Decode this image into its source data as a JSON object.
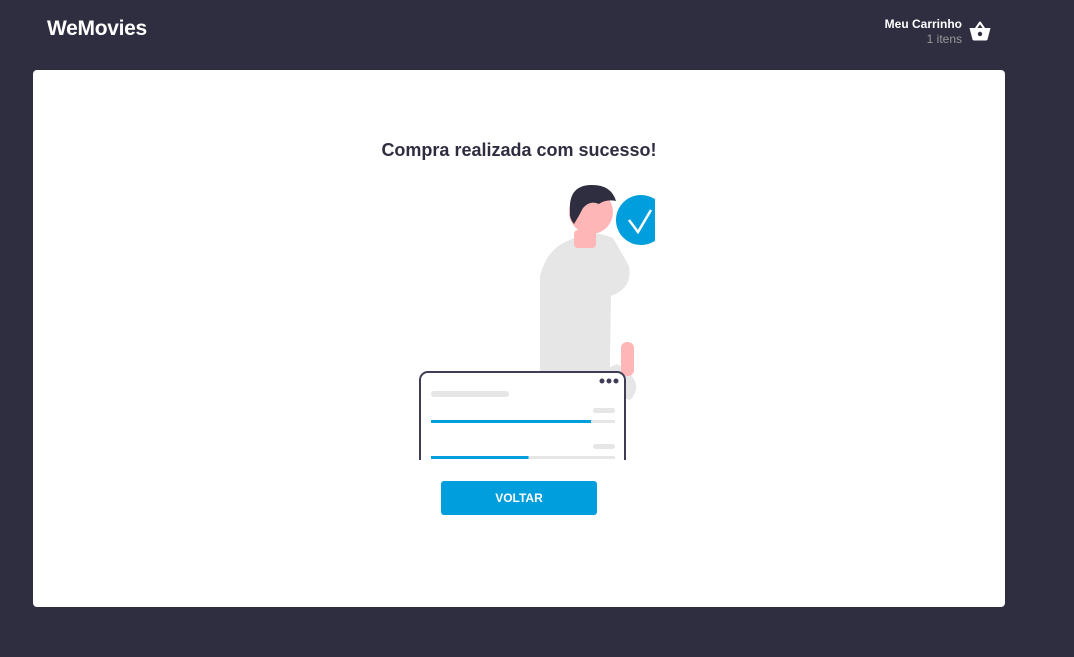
{
  "header": {
    "logo": "WeMovies",
    "cart": {
      "title": "Meu Carrinho",
      "count_label": "1 itens",
      "icon": "basket-icon"
    }
  },
  "main": {
    "success_message": "Compra realizada com sucesso!",
    "illustration": {
      "icon": "check-circle-icon",
      "progress_bars": [
        0.87,
        0.53
      ]
    },
    "back_button_label": "VOLTAR"
  },
  "colors": {
    "background": "#2f2e41",
    "card": "#ffffff",
    "accent": "#009edd",
    "text_dark": "#2f2e41",
    "muted": "#999999"
  }
}
